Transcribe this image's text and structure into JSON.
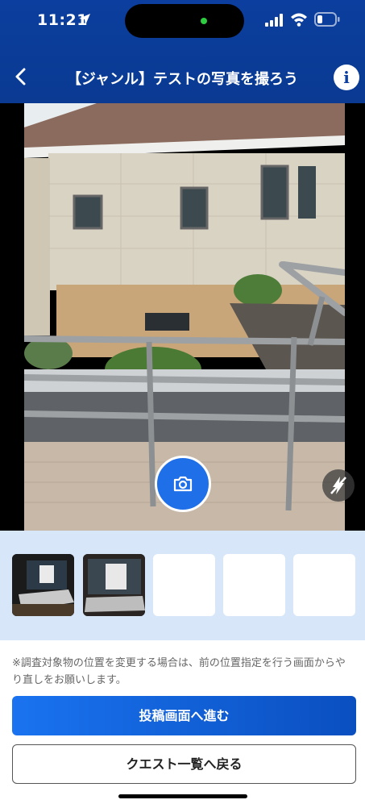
{
  "status_bar": {
    "time": "11:21"
  },
  "header": {
    "title": "【ジャンル】テストの写真を撮ろう",
    "info_label": "i"
  },
  "camera": {
    "shutter_icon": "camera-icon",
    "flash_icon": "flash-off-icon"
  },
  "thumbnails": [
    {
      "state": "filled",
      "description": "laptop-photo"
    },
    {
      "state": "filled",
      "description": "laptop-photo"
    },
    {
      "state": "empty"
    },
    {
      "state": "empty"
    },
    {
      "state": "empty"
    }
  ],
  "note": "※調査対象物の位置を変更する場合は、前の位置指定を行う画面からやり直しをお願いします。",
  "buttons": {
    "primary": "投稿画面へ進む",
    "secondary": "クエスト一覧へ戻る"
  },
  "colors": {
    "header": "#0b3e9e",
    "accent": "#1f6fe8",
    "thumb_area": "#d7e7f9"
  }
}
